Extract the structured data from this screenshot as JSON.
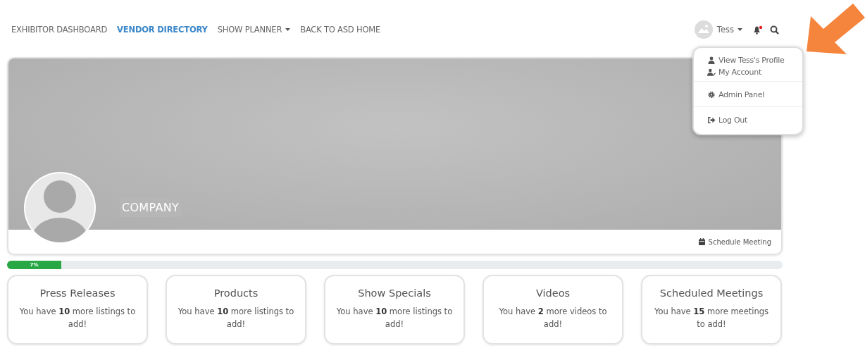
{
  "nav": {
    "items": [
      {
        "label": "EXHIBITOR DASHBOARD",
        "selected": false,
        "has_menu": false
      },
      {
        "label": "VENDOR DIRECTORY",
        "selected": true,
        "has_menu": false
      },
      {
        "label": "SHOW PLANNER",
        "selected": false,
        "has_menu": true
      },
      {
        "label": "BACK TO ASD HOME",
        "selected": false,
        "has_menu": false
      }
    ],
    "user": {
      "name": "Tess",
      "notification": true
    }
  },
  "user_menu": {
    "groups": [
      [
        {
          "kind": "profile",
          "label": "View Tess's Profile"
        },
        {
          "kind": "account",
          "label": "My Account"
        }
      ],
      [
        {
          "kind": "admin",
          "label": "Admin Panel"
        }
      ],
      [
        {
          "kind": "logout",
          "label": "Log Out"
        }
      ]
    ]
  },
  "banner": {
    "company": "COMPANY",
    "action": "Schedule Meeting"
  },
  "progress": {
    "level": 0.07,
    "reading": "7%"
  },
  "cards": [
    {
      "title": "Press Releases",
      "text": "You have **10** more listings to add!"
    },
    {
      "title": "Products",
      "text": "You have **10** more listings to add!"
    },
    {
      "title": "Show Specials",
      "text": "You have **10** more listings to add!"
    },
    {
      "title": "Videos",
      "text": "You have **2** more videos to add!"
    },
    {
      "title": "Scheduled Meetings",
      "text": "You have **15** more meetings to add!"
    }
  ]
}
